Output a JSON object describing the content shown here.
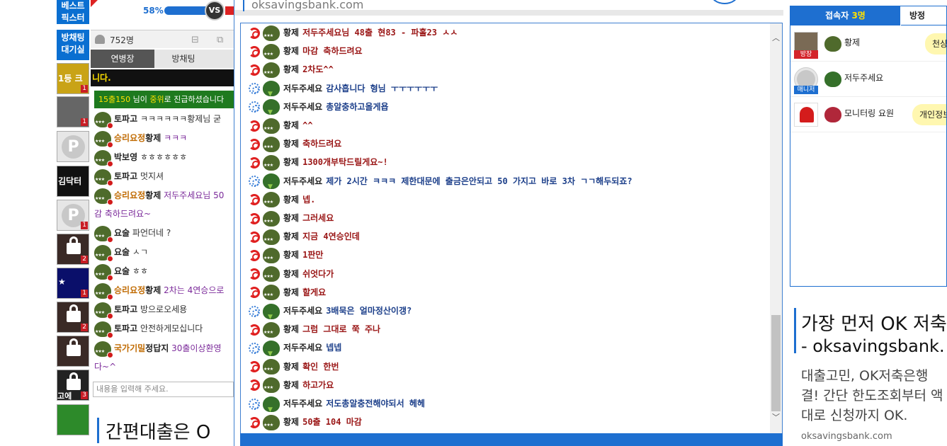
{
  "left_buttons": [
    "베스트\n픽스터",
    "방채팅\n대기실"
  ],
  "left_thumbs": [
    {
      "badge": "1",
      "kind": "image",
      "color": "#c9a316",
      "label": "1등 크"
    },
    {
      "badge": "1",
      "kind": "image",
      "color": "#666666",
      "label": ""
    },
    {
      "badge": "",
      "kind": "logo",
      "color": "#e6e6e6",
      "label": "P"
    },
    {
      "badge": "",
      "kind": "image",
      "color": "#111111",
      "label": "김닥터"
    },
    {
      "badge": "1",
      "kind": "logo",
      "color": "#e6e6e6",
      "label": "P"
    },
    {
      "badge": "2",
      "kind": "lock",
      "color": "#3a2a26",
      "label": ""
    },
    {
      "badge": "1",
      "kind": "image",
      "color": "#0a0f6a",
      "label": "★"
    },
    {
      "badge": "2",
      "kind": "lock",
      "color": "#3a2a26",
      "label": ""
    },
    {
      "badge": "",
      "kind": "lock",
      "color": "#3a2a26",
      "label": ""
    },
    {
      "badge": "3",
      "kind": "lock",
      "color": "#222222",
      "label": "고에"
    },
    {
      "badge": "",
      "kind": "image",
      "color": "#2d8a2a",
      "label": ""
    }
  ],
  "vs": {
    "percent": "58%",
    "label": "VS"
  },
  "left_chat": {
    "viewer_count": "752명",
    "tabs": [
      "연병장",
      "방채팅"
    ],
    "notice_yellow": "니다.",
    "notice_green_user": "15출150",
    "notice_green_text": " 님이 ",
    "notice_green_rank": "중위",
    "notice_green_text2": "로 진급하셨습니다",
    "messages": [
      {
        "nick": "토파고",
        "vip": false,
        "text": "ㅋㅋㅋㅋㅋㅋ황제님 굳",
        "purple": false
      },
      {
        "nick": "승리요정",
        "vip": true,
        "nick2": "황제",
        "text": "ㅋㅋㅋ",
        "purple": true
      },
      {
        "nick": "박보영",
        "vip": false,
        "text": "ㅎㅎㅎㅎㅎㅎ",
        "purple": false
      },
      {
        "nick": "토파고",
        "vip": false,
        "text": "멋지셔",
        "purple": false
      },
      {
        "nick": "승리요정",
        "vip": true,
        "nick2": "황제",
        "text": "저두주세요님 50",
        "purple": true
      },
      {
        "nick": "",
        "vip": false,
        "text": "감 축하드려요~",
        "purple": true
      },
      {
        "nick": "요술",
        "vip": false,
        "text": "파언더네 ?",
        "purple": false
      },
      {
        "nick": "요술",
        "vip": false,
        "text": "ㅅㄱ",
        "purple": false
      },
      {
        "nick": "요술",
        "vip": false,
        "text": "ㅎㅎ",
        "purple": false
      },
      {
        "nick": "승리요정",
        "vip": true,
        "nick2": "황제",
        "text": "2차는 4연승으로",
        "purple": true
      },
      {
        "nick": "토파고",
        "vip": false,
        "text": "방으로오세용",
        "purple": false
      },
      {
        "nick": "토파고",
        "vip": false,
        "text": "안전하게모십니다",
        "purple": false
      },
      {
        "nick": "국가기밀",
        "vip": true,
        "nick2": "정답지",
        "text": "30출이상환영",
        "purple": true
      },
      {
        "nick": "",
        "vip": false,
        "text": "다~^",
        "purple": true
      }
    ],
    "input_placeholder": "내용을 입력해 주세요."
  },
  "main_chat": {
    "url": "oksavingsbank.com",
    "messages": [
      {
        "icon": "red",
        "nick": "황제",
        "text": "저두주세요님 48출 현83 - 파홀23 ㅅㅅ",
        "color": "red"
      },
      {
        "icon": "red",
        "nick": "황제",
        "text": "마감 축하드려요",
        "color": "red"
      },
      {
        "icon": "red",
        "nick": "황제",
        "text": "2차도^^",
        "color": "red"
      },
      {
        "icon": "blue",
        "nick": "저두주세요",
        "text": "감사흡니다 형님 ㅜㅜㅜㅜㅜㅜ",
        "color": "blue"
      },
      {
        "icon": "blue",
        "nick": "저두주세요",
        "text": "총알충하고올게욥",
        "color": "blue"
      },
      {
        "icon": "red",
        "nick": "황제",
        "text": "^^",
        "color": "red"
      },
      {
        "icon": "red",
        "nick": "황제",
        "text": "축하드려요",
        "color": "red"
      },
      {
        "icon": "red",
        "nick": "황제",
        "text": "1300개부탁드릴게요~!",
        "color": "red"
      },
      {
        "icon": "blue",
        "nick": "저두주세요",
        "text": "제가 2시간 ㅋㅋㅋ 제한대문에 출금은안되고 50 가지고 바로 3차 ㄱㄱ해두되죠?",
        "color": "blue"
      },
      {
        "icon": "red",
        "nick": "황제",
        "text": "넵.",
        "color": "red"
      },
      {
        "icon": "red",
        "nick": "황제",
        "text": "그러세요",
        "color": "red"
      },
      {
        "icon": "red",
        "nick": "황제",
        "text": "지금 4연승인데",
        "color": "red"
      },
      {
        "icon": "red",
        "nick": "황제",
        "text": "1판만",
        "color": "red"
      },
      {
        "icon": "red",
        "nick": "황제",
        "text": "쉬엇다가",
        "color": "red"
      },
      {
        "icon": "red",
        "nick": "황제",
        "text": "할게요",
        "color": "red"
      },
      {
        "icon": "blue",
        "nick": "저두주세요",
        "text": "3배묵은 얼마정산이갱?",
        "color": "blue"
      },
      {
        "icon": "red",
        "nick": "황제",
        "text": "그럼 그대로 쭉 주나",
        "color": "red"
      },
      {
        "icon": "blue",
        "nick": "저두주세요",
        "text": "넵넵",
        "color": "blue"
      },
      {
        "icon": "red",
        "nick": "황제",
        "text": "확인 한번",
        "color": "red"
      },
      {
        "icon": "red",
        "nick": "황제",
        "text": "하고가요",
        "color": "red"
      },
      {
        "icon": "blue",
        "nick": "저두주세요",
        "text": "저도총알충전해야되서 헤헤",
        "color": "blue"
      },
      {
        "icon": "red",
        "nick": "황제",
        "text": "50출 104 마감",
        "color": "red"
      }
    ]
  },
  "users_panel": {
    "tab_label": "접속자",
    "tab_count": "3명",
    "tab2_label": "방정",
    "users": [
      {
        "name": "황제",
        "role": "방장",
        "role_color": "red",
        "bubble": "천상"
      },
      {
        "name": "저두주세요",
        "role": "매니저",
        "role_color": "blue",
        "bubble": ""
      },
      {
        "name": "모니터링 요원",
        "role": "",
        "role_color": "",
        "bubble": "개인정보"
      }
    ]
  },
  "ads": {
    "left_text": "간편대출은 O",
    "right_title": "가장 먼저 OK 저축",
    "right_url": "- oksavingsbank.",
    "right_body": "대출고민, OK저축은행 결! 간단 한도조회부터 액대로 신청까지 OK.",
    "right_footer": "oksavingsbank.com"
  }
}
